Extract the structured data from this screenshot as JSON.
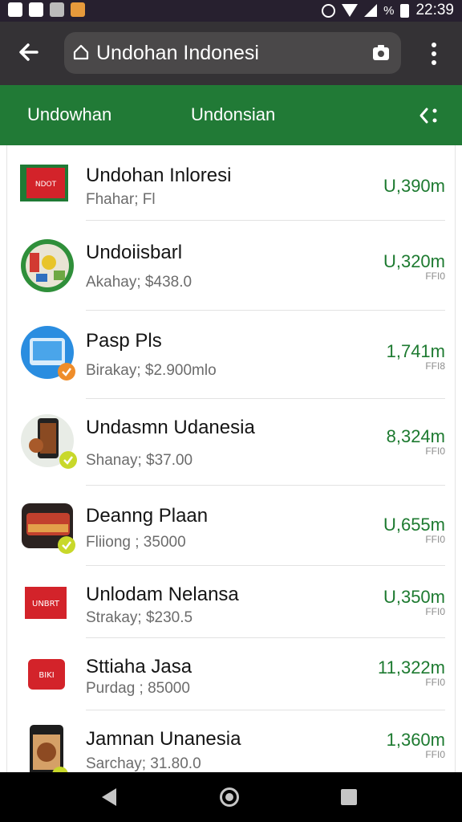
{
  "status_bar": {
    "time": "22:39",
    "battery_text": "%",
    "icons": [
      "image-icon",
      "notification-icon",
      "link-icon",
      "app-icon",
      "alarm-icon",
      "wifi-icon",
      "signal-icon",
      "battery-icon"
    ]
  },
  "toolbar": {
    "url_text": "Undohan Indonesi",
    "icons": [
      "back-arrow-icon",
      "home-icon",
      "lens-icon",
      "overflow-menu-icon"
    ]
  },
  "header": {
    "tab1": "Undowhan",
    "tab2": "Undonsian",
    "share_icon": "share-icon"
  },
  "colors": {
    "status_bar": "#27202f",
    "toolbar": "#343235",
    "accent_green": "#217a36",
    "value_green": "#1d7a30"
  },
  "items": [
    {
      "title": "Undohan Inloresi",
      "subtitle": "Fhahar; Fl",
      "value": "U,390m",
      "unit": "",
      "icon": "red-flag-icon"
    },
    {
      "title": "Undoiisbarl",
      "subtitle": "Akahay; $438.0",
      "value": "U,320m",
      "unit": "FFI0",
      "icon": "app-collage-icon"
    },
    {
      "title": "Pasp Pls",
      "subtitle": "Birakay; $2.900mlo",
      "value": "1,741m",
      "unit": "FFI8",
      "icon": "tablet-app-icon"
    },
    {
      "title": "Undasmn Udanesia",
      "subtitle": "Shanay; $37.00",
      "value": "8,324m",
      "unit": "FFI0",
      "icon": "phone-food-icon"
    },
    {
      "title": "Deanng Plaan",
      "subtitle": "Fliiong ; 35000",
      "value": "U,655m",
      "unit": "FFI0",
      "icon": "food-dish-icon"
    },
    {
      "title": "Unlodam Nelansa",
      "subtitle": "Strakay; $230.5",
      "value": "U,350m",
      "unit": "FFI0",
      "icon": "red-sign-icon"
    },
    {
      "title": "Sttiaha Jasa",
      "subtitle": "Purdag ; 85000",
      "value": "11,322m",
      "unit": "FFI0",
      "icon": "red-badge-icon"
    },
    {
      "title": "Jamnan Unanesia",
      "subtitle": "Sarchay; 31.80.0",
      "value": "1,360m",
      "unit": "FFI0",
      "icon": "phone-meal-icon"
    }
  ],
  "navbar": {
    "icons": [
      "nav-back-icon",
      "nav-home-icon",
      "nav-recents-icon"
    ]
  }
}
